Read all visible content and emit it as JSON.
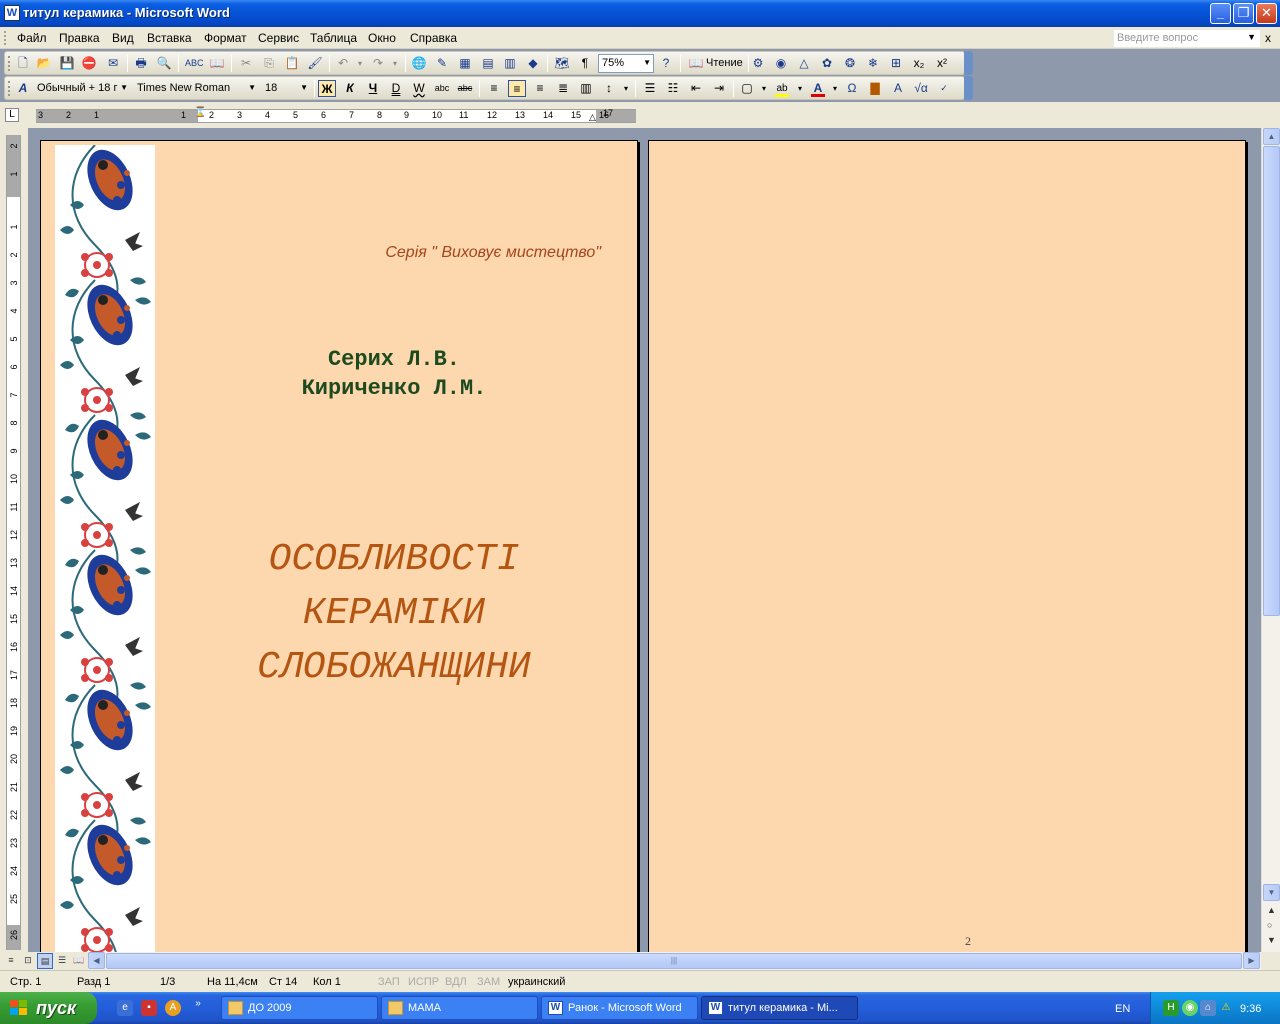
{
  "window": {
    "title": "титул керамика - Microsoft Word",
    "app_icon": "W",
    "buttons": {
      "minimize": "_",
      "maximize": "❐",
      "close": "✕"
    }
  },
  "menubar": {
    "items": [
      {
        "label": "Файл"
      },
      {
        "label": "Правка"
      },
      {
        "label": "Вид"
      },
      {
        "label": "Вставка"
      },
      {
        "label": "Формат"
      },
      {
        "label": "Сервис"
      },
      {
        "label": "Таблица"
      },
      {
        "label": "Окно"
      },
      {
        "label": "Справка"
      }
    ],
    "ask_placeholder": "Введите вопрос",
    "doc_close": "x"
  },
  "toolbar_standard": {
    "zoom": "75%",
    "reading_label": "Чтение",
    "icons": [
      "new-icon",
      "open-icon",
      "save-icon",
      "permission-icon",
      "email-icon",
      "print-icon",
      "print-preview-icon",
      "spelling-icon",
      "research-icon",
      "cut-icon",
      "copy-icon",
      "paste-icon",
      "format-painter-icon",
      "undo-icon",
      "redo-icon",
      "hyperlink-icon",
      "tables-borders-icon",
      "insert-table-icon",
      "columns-icon",
      "drawing-icon",
      "document-map-icon",
      "show-formatting-icon",
      "help-icon"
    ]
  },
  "toolbar_formatting": {
    "style": "Обычный + 18 г",
    "font": "Times New Roman",
    "size": "18",
    "bold": "Ж",
    "italic": "К",
    "underline": "Ч",
    "font_color": "#e00000",
    "highlight_color": "#ffff00"
  },
  "ruler": {
    "h_numbers": [
      "3",
      "2",
      "1",
      "1",
      "2",
      "3",
      "4",
      "5",
      "6",
      "7",
      "8",
      "9",
      "10",
      "11",
      "12",
      "13",
      "14",
      "15",
      "16",
      "17"
    ],
    "v_numbers": [
      "2",
      "1",
      "1",
      "2",
      "3",
      "4",
      "5",
      "6",
      "7",
      "8",
      "9",
      "10",
      "11",
      "12",
      "13",
      "14",
      "15",
      "16",
      "17",
      "18",
      "19",
      "20",
      "21",
      "22",
      "23",
      "24",
      "25",
      "26"
    ]
  },
  "document": {
    "page_color": "#fdd7ad",
    "series": "Серія \"  Виховує мистецтво\"",
    "authors": [
      "Серих Л.В.",
      "Кириченко Л.М."
    ],
    "title_lines": [
      "ОСОБЛИВОСТІ",
      "КЕРАМІКИ",
      "СЛОБОЖАНЩИНИ"
    ],
    "page_number": "2"
  },
  "statusbar": {
    "page": "Стр. 1",
    "section": "Разд 1",
    "pages": "1/3",
    "at": "На 11,4см",
    "line": "Ст 14",
    "col": "Кол 1",
    "rec": "ЗАП",
    "trk": "ИСПР",
    "ext": "ВДЛ",
    "ovr": "ЗАМ",
    "language": "украинский"
  },
  "taskbar": {
    "start_label": "пуск",
    "tasks": [
      {
        "label": "ДО 2009",
        "icon": "folder-icon"
      },
      {
        "label": "МАМА",
        "icon": "folder-icon"
      },
      {
        "label": "Ранок - Microsoft Word",
        "icon": "word-icon"
      },
      {
        "label": "титул керамика - Mi...",
        "icon": "word-icon",
        "active": true
      }
    ],
    "language": "EN",
    "clock": "9:36",
    "more": "»"
  }
}
